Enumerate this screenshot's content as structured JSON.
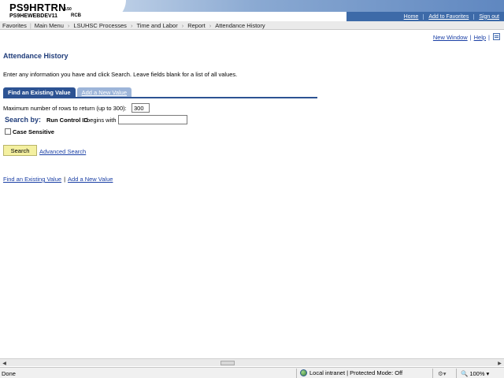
{
  "header": {
    "app_title": "PS9HRTRN",
    "version": "8.50",
    "server": "PS9HEWEBDEV11",
    "server_code": "RCB",
    "links": [
      "Home",
      "Add to Favorites",
      "Sign out"
    ]
  },
  "nav": {
    "items": [
      "Favorites",
      "Main Menu",
      "LSUHSC Processes",
      "Time and Labor",
      "Report",
      "Attendance History"
    ]
  },
  "top_links": {
    "new_window": "New Window",
    "help": "Help"
  },
  "page": {
    "title": "Attendance History",
    "instructions": "Enter any information you have and click Search. Leave fields blank for a list of all values."
  },
  "tabs": {
    "active": "Find an Existing Value",
    "inactive": "Add a New Value"
  },
  "search": {
    "max_rows_label": "Maximum number of rows to return (up to 300):",
    "max_rows_value": "300",
    "search_by_label": "Search by:",
    "field_label": "Run Control ID",
    "operator": "begins with",
    "field_value": "",
    "case_sensitive_label": "Case Sensitive",
    "search_button": "Search",
    "advanced_search": "Advanced Search"
  },
  "bottom_links": {
    "find": "Find an Existing Value",
    "add": "Add a New Value"
  },
  "status_bar": {
    "state": "Done",
    "zone": "Local intranet | Protected Mode: Off",
    "zoom": "100%"
  },
  "colors": {
    "header_blue": "#3d6aa8",
    "tab_active": "#2d5393",
    "link": "#1a3fa5",
    "search_button": "#f4f0a0"
  }
}
